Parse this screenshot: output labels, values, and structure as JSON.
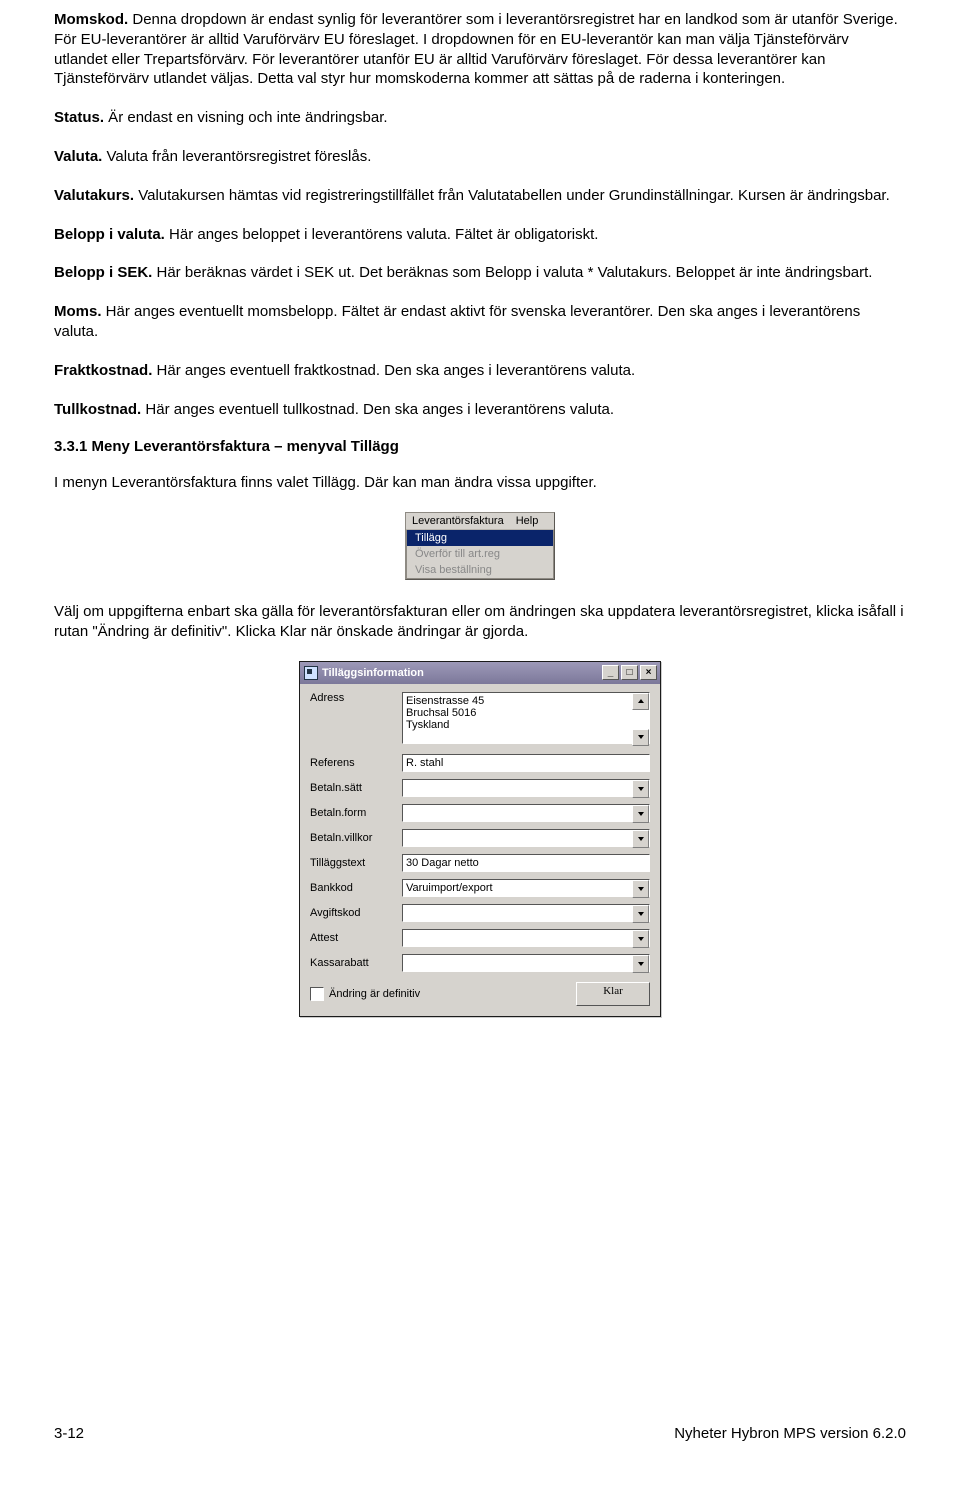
{
  "paragraphs": {
    "momskod_label": "Momskod.",
    "momskod_text": " Denna dropdown är endast synlig för leverantörer som i leverantörsregistret har en landkod som är utanför Sverige. För EU-leverantörer är alltid Varuförvärv EU föreslaget. I dropdownen för en EU-leverantör kan man välja Tjänsteförvärv utlandet eller Trepartsförvärv. För leverantörer utanför EU är alltid Varuförvärv föreslaget. För dessa leverantörer kan Tjänsteförvärv utlandet väljas. Detta val styr hur momskoderna kommer att sättas på de raderna i konteringen.",
    "status_label": "Status.",
    "status_text": " Är endast en visning och inte ändringsbar.",
    "valuta_label": "Valuta.",
    "valuta_text": " Valuta från leverantörsregistret föreslås.",
    "valutakurs_label": "Valutakurs.",
    "valutakurs_text": " Valutakursen hämtas vid registreringstillfället från Valutatabellen under Grundinställningar. Kursen är ändringsbar.",
    "belopp_valuta_label": "Belopp i valuta.",
    "belopp_valuta_text": " Här anges beloppet i leverantörens valuta. Fältet är obligatoriskt.",
    "belopp_sek_label": "Belopp i SEK.",
    "belopp_sek_text": " Här beräknas värdet i SEK ut. Det beräknas som Belopp i valuta * Valutakurs. Beloppet är inte ändringsbart.",
    "moms_label": "Moms.",
    "moms_text": " Här anges eventuellt momsbelopp. Fältet är endast aktivt för svenska leverantörer. Den ska anges i leverantörens valuta.",
    "fraktkostnad_label": "Fraktkostnad.",
    "fraktkostnad_text": " Här anges eventuell fraktkostnad. Den ska anges i leverantörens valuta.",
    "tullkostnad_label": "Tullkostnad.",
    "tullkostnad_text": " Här anges eventuell tullkostnad. Den ska anges i leverantörens valuta."
  },
  "section_heading": "3.3.1  Meny Leverantörsfaktura – menyval Tillägg",
  "section_intro": "I menyn Leverantörsfaktura finns valet Tillägg. Där kan man ändra vissa uppgifter.",
  "section_after_menu": "Välj om uppgifterna enbart ska gälla för leverantörsfakturan eller om ändringen ska uppdatera leverantörsregistret, klicka isåfall i rutan \"Ändring är definitiv\". Klicka Klar när önskade ändringar är gjorda.",
  "menu": {
    "topbar_left": "Leverantörsfaktura",
    "topbar_right": "Help",
    "items": [
      "Tillägg",
      "Överför till art.reg",
      "Visa beställning"
    ],
    "selected_index": 0
  },
  "dialog": {
    "title": "Tilläggsinformation",
    "address_label": "Adress",
    "address_value": "Eisenstrasse 45\nBruchsal 5016\nTyskland",
    "referens_label": "Referens",
    "referens_value": "R. stahl",
    "betalnsatt_label": "Betaln.sätt",
    "betalnform_label": "Betaln.form",
    "betalnvillkor_label": "Betaln.villkor",
    "tillaggstext_label": "Tilläggstext",
    "tillaggstext_value": "30 Dagar netto",
    "bankkod_label": "Bankkod",
    "bankkod_value": "Varuimport/export",
    "avgiftskod_label": "Avgiftskod",
    "attest_label": "Attest",
    "kassarabatt_label": "Kassarabatt",
    "check_label": "Ändring är definitiv",
    "ok_label": "Klar"
  },
  "footer": {
    "left": "3-12",
    "right": "Nyheter Hybron MPS version 6.2.0"
  }
}
